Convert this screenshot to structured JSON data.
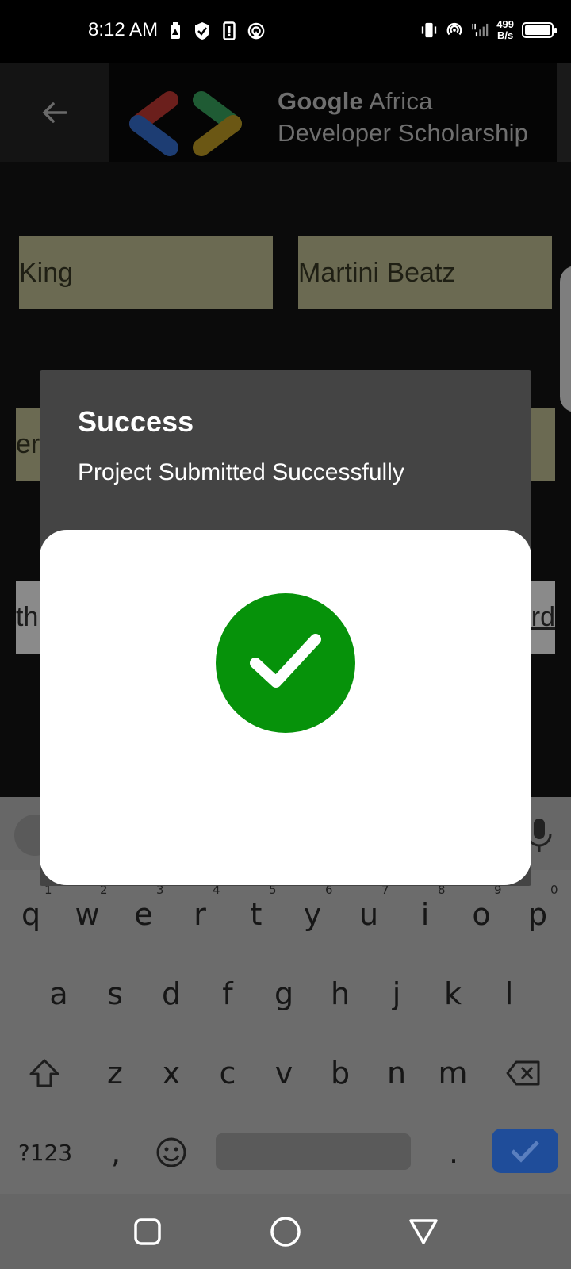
{
  "status_bar": {
    "time": "8:12 AM",
    "net_speed_value": "499",
    "net_speed_unit": "B/s",
    "icons": [
      "battery-saver-icon",
      "shield-icon",
      "phone-icon",
      "hotspot-icon",
      "vibrate-icon",
      "hotspot-icon",
      "signal-icon",
      "battery-icon"
    ]
  },
  "toolbar": {
    "banner_line1_bold": "Google",
    "banner_line1_rest": " Africa",
    "banner_line2": "Developer Scholarship"
  },
  "form": {
    "first_name": "King",
    "last_name": "Martini Beatz",
    "email_partial": "er",
    "link_partial_left": "th",
    "link_partial_right": "rd"
  },
  "dialog": {
    "title": "Success",
    "message": "Project Submitted Successfully"
  },
  "keyboard": {
    "row1": [
      "q",
      "w",
      "e",
      "r",
      "t",
      "y",
      "u",
      "i",
      "o",
      "p"
    ],
    "row1_numbers": [
      "1",
      "2",
      "3",
      "4",
      "5",
      "6",
      "7",
      "8",
      "9",
      "0"
    ],
    "row2": [
      "a",
      "s",
      "d",
      "f",
      "g",
      "h",
      "j",
      "k",
      "l"
    ],
    "row3": [
      "z",
      "x",
      "c",
      "v",
      "b",
      "n",
      "m"
    ],
    "symbols_label": "?123",
    "comma": ",",
    "period": "."
  },
  "colors": {
    "success_green": "#06920a",
    "enter_blue": "#1f4d9a",
    "field_tan": "#6b6a52"
  }
}
